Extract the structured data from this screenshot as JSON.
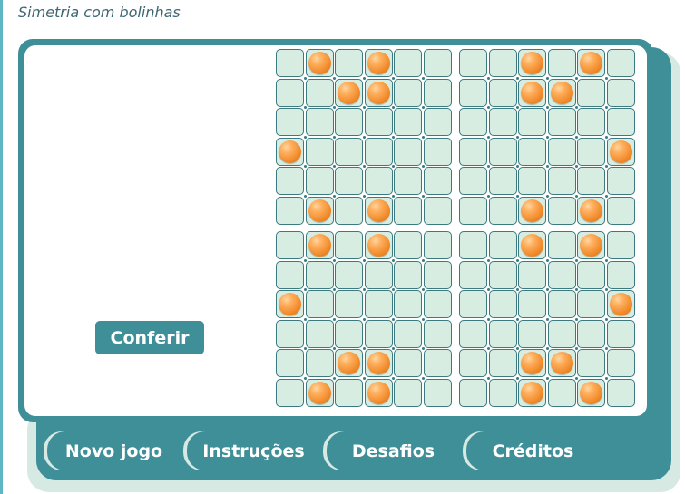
{
  "title": "Simetria com bolinhas",
  "check_button": "Conferir",
  "tabs": [
    "Novo jogo",
    "Instruções",
    "Desafios",
    "Créditos"
  ],
  "board": {
    "cols": 12,
    "rows": 12,
    "balls": [
      [
        0,
        1
      ],
      [
        0,
        3
      ],
      [
        0,
        8
      ],
      [
        0,
        10
      ],
      [
        1,
        2
      ],
      [
        1,
        3
      ],
      [
        1,
        8
      ],
      [
        1,
        9
      ],
      [
        3,
        0
      ],
      [
        3,
        11
      ],
      [
        5,
        1
      ],
      [
        5,
        3
      ],
      [
        5,
        8
      ],
      [
        5,
        10
      ],
      [
        6,
        1
      ],
      [
        6,
        3
      ],
      [
        6,
        8
      ],
      [
        6,
        10
      ],
      [
        8,
        0
      ],
      [
        8,
        11
      ],
      [
        10,
        2
      ],
      [
        10,
        3
      ],
      [
        10,
        8
      ],
      [
        10,
        9
      ],
      [
        11,
        1
      ],
      [
        11,
        3
      ],
      [
        11,
        8
      ],
      [
        11,
        10
      ]
    ]
  },
  "colors": {
    "panel": "#3f8f98",
    "cell": "#d8ede2",
    "ball": "#f08a2a"
  }
}
